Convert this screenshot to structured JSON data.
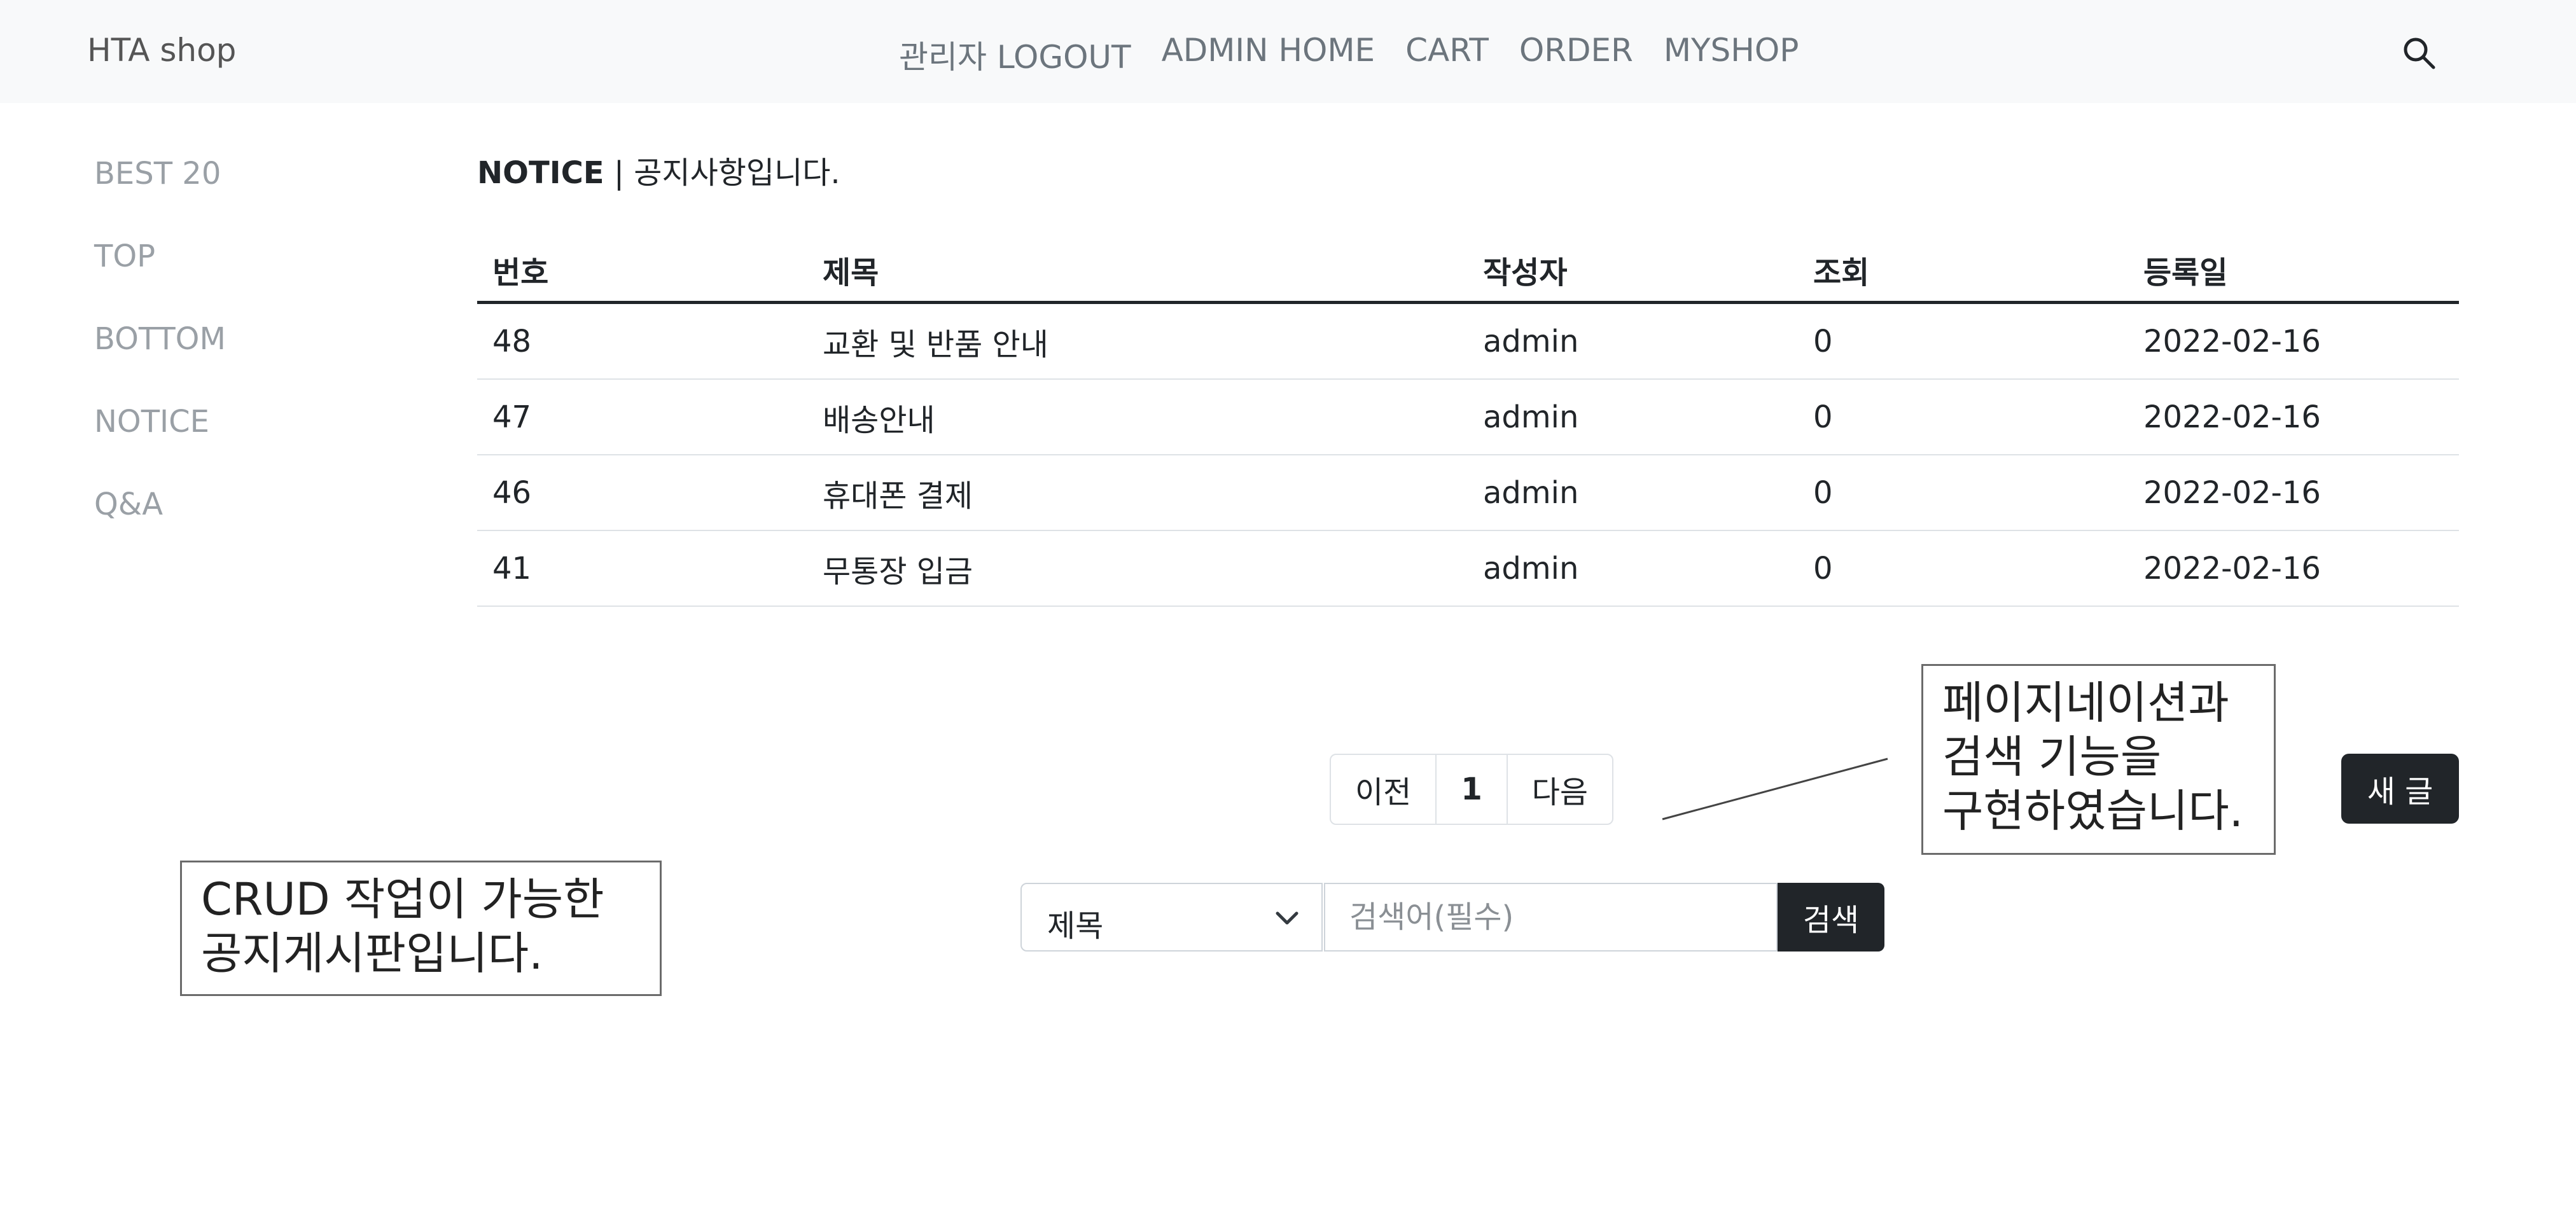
{
  "navbar": {
    "brand": "HTA shop",
    "links": [
      "관리자 LOGOUT",
      "ADMIN HOME",
      "CART",
      "ORDER",
      "MYSHOP"
    ],
    "search_icon": "search-icon"
  },
  "sidebar": {
    "items": [
      "BEST 20",
      "TOP",
      "BOTTOM",
      "NOTICE",
      "Q&A"
    ]
  },
  "notice": {
    "title_bold": "NOTICE",
    "title_rest": " | 공지사항입니다."
  },
  "table": {
    "headers": [
      "번호",
      "제목",
      "작성자",
      "조회",
      "등록일"
    ],
    "rows": [
      [
        "48",
        "교환 및 반품 안내",
        "admin",
        "0",
        "2022-02-16"
      ],
      [
        "47",
        "배송안내",
        "admin",
        "0",
        "2022-02-16"
      ],
      [
        "46",
        "휴대폰 결제",
        "admin",
        "0",
        "2022-02-16"
      ],
      [
        "41",
        "무통장 입금",
        "admin",
        "0",
        "2022-02-16"
      ]
    ]
  },
  "pagination": {
    "prev": "이전",
    "current": "1",
    "next": "다음"
  },
  "new_post_button": "새 글",
  "search": {
    "select_value": "제목",
    "input_value": "",
    "input_placeholder": "검색어(필수)",
    "button": "검색"
  },
  "annotations": {
    "left": [
      "CRUD 작업이 가능한",
      "공지게시판입니다."
    ],
    "right": [
      "페이지네이션과",
      "검색 기능을",
      "구현하였습니다."
    ]
  }
}
